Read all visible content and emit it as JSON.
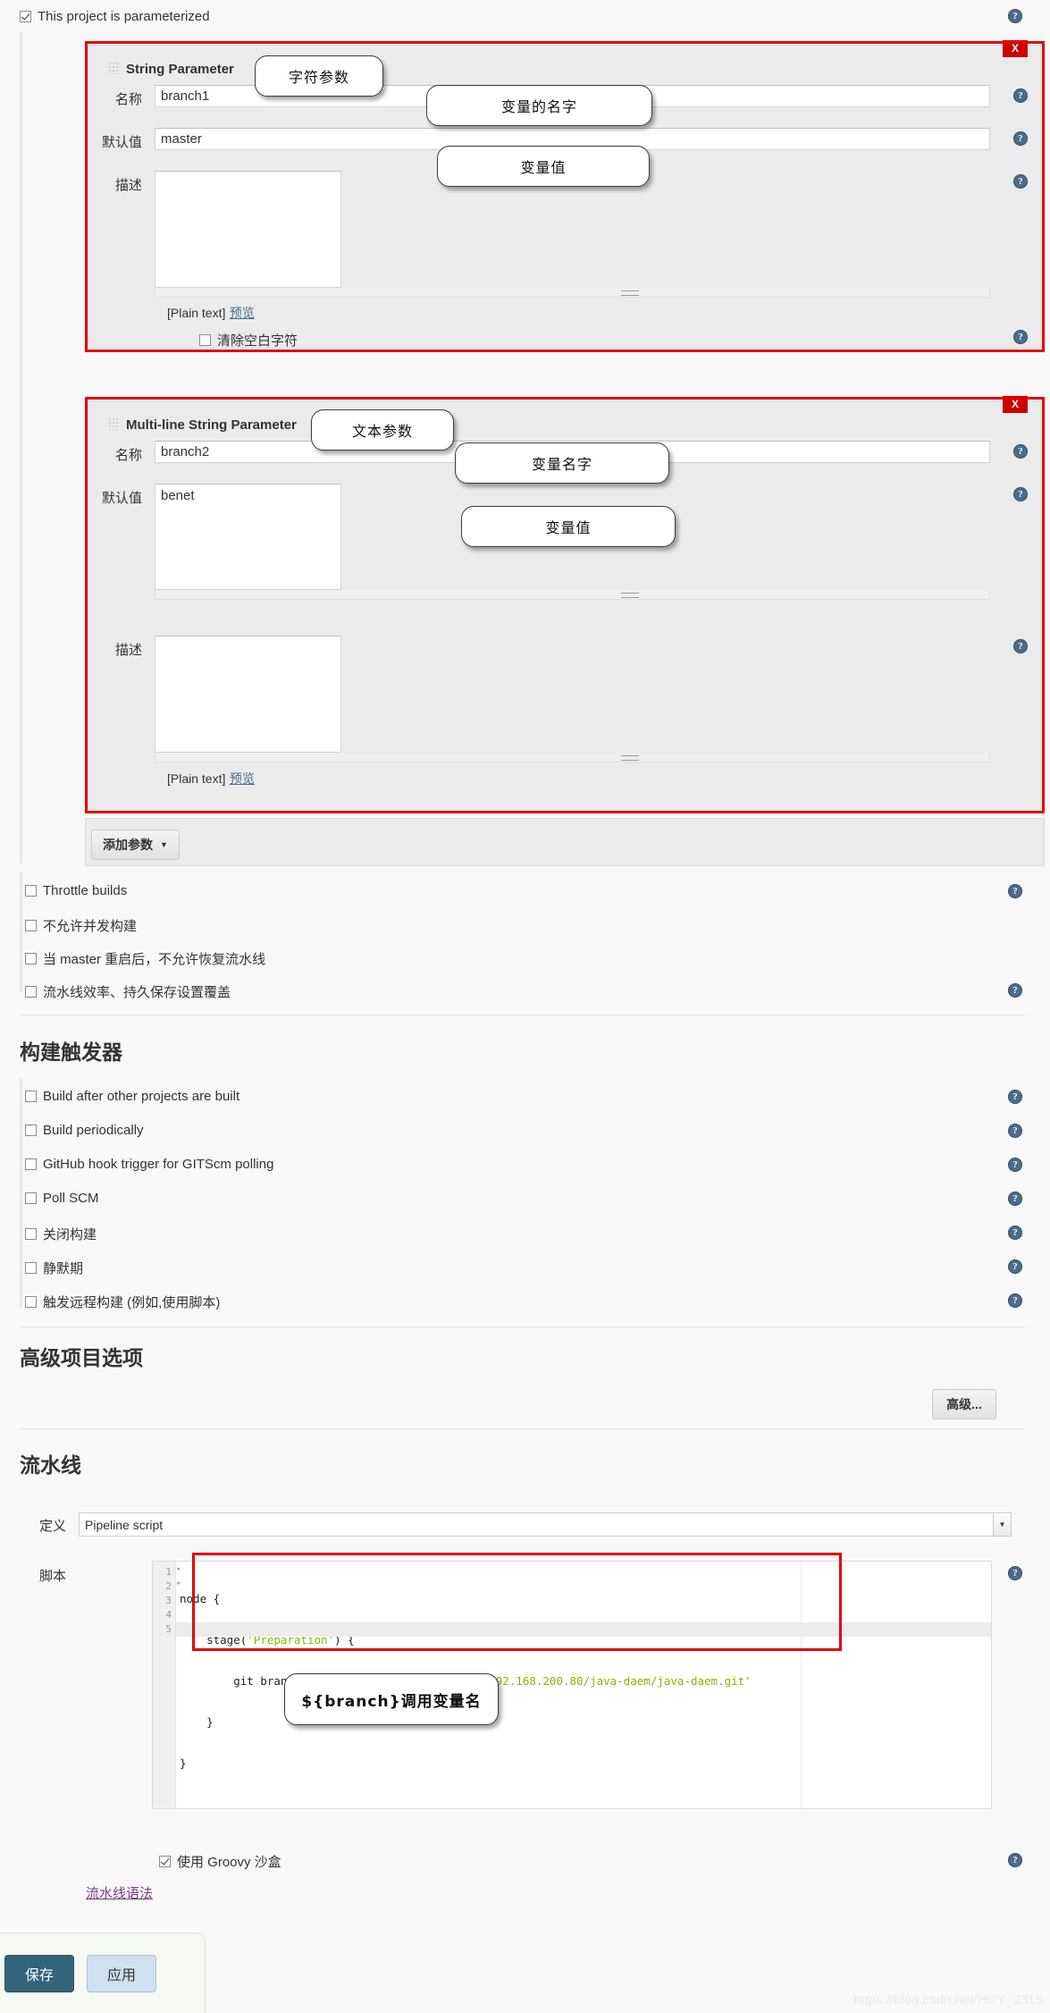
{
  "top": {
    "parameterized_label": "This project is parameterized",
    "parameterized_checked": true
  },
  "parameters": [
    {
      "type_title": "String Parameter",
      "delete_label": "X",
      "name_label": "名称",
      "name_value": "branch1",
      "default_label": "默认值",
      "default_value": "master",
      "description_label": "描述",
      "description_value": "",
      "plain_text_note": "[Plain text]",
      "preview_link": "预览",
      "trim_label": "清除空白字符",
      "trim_checked": false
    },
    {
      "type_title": "Multi-line String Parameter",
      "delete_label": "X",
      "name_label": "名称",
      "name_value": "branch2",
      "default_label": "默认值",
      "default_value": "benet",
      "description_label": "描述",
      "description_value": "",
      "plain_text_note": "[Plain text]",
      "preview_link": "预览"
    }
  ],
  "callouts": [
    {
      "text": "字符参数"
    },
    {
      "text": "变量的名字"
    },
    {
      "text": "变量值"
    },
    {
      "text": "文本参数"
    },
    {
      "text": "变量名字"
    },
    {
      "text": "变量值"
    },
    {
      "text": "${branch}调用变量名"
    }
  ],
  "add_param_button": {
    "label": "添加参数",
    "caret": "▼"
  },
  "general_options": [
    {
      "label": "Throttle builds",
      "checked": false,
      "help": true
    },
    {
      "label": "不允许并发构建",
      "checked": false,
      "help": false
    },
    {
      "label": "当 master 重启后，不允许恢复流水线",
      "checked": false,
      "help": false
    },
    {
      "label": "流水线效率、持久保存设置覆盖",
      "checked": false,
      "help": true
    }
  ],
  "build_triggers": {
    "heading": "构建触发器",
    "options": [
      {
        "label": "Build after other projects are built",
        "checked": false
      },
      {
        "label": "Build periodically",
        "checked": false
      },
      {
        "label": "GitHub hook trigger for GITScm polling",
        "checked": false
      },
      {
        "label": "Poll SCM",
        "checked": false
      },
      {
        "label": "关闭构建",
        "checked": false
      },
      {
        "label": "静默期",
        "checked": false
      },
      {
        "label": "触发远程构建 (例如,使用脚本)",
        "checked": false
      }
    ]
  },
  "advanced_project_options": {
    "heading": "高级项目选项",
    "advanced_button": "高级..."
  },
  "pipeline": {
    "heading": "流水线",
    "definition_label": "定义",
    "definition_value": "Pipeline script",
    "definition_caret": "▼",
    "script_label": "脚本",
    "script_lines": [
      {
        "no": "1",
        "fold": "▾",
        "text": "node {"
      },
      {
        "no": "2",
        "fold": "▾",
        "text": "    stage('Preparation') {"
      },
      {
        "no": "3",
        "fold": "",
        "text": "        git branch: '${branch}', url: 'http://192.168.200.80/java-daem/java-daem.git'"
      },
      {
        "no": "4",
        "fold": "",
        "text": "    }"
      },
      {
        "no": "5",
        "fold": "",
        "text": "}"
      }
    ],
    "sandbox_label": "使用 Groovy 沙盒",
    "sandbox_checked": true,
    "syntax_link": "流水线语法"
  },
  "footer": {
    "save_label": "保存",
    "apply_label": "应用"
  },
  "watermark": "https://blog.csdn.net/HCY_2315"
}
